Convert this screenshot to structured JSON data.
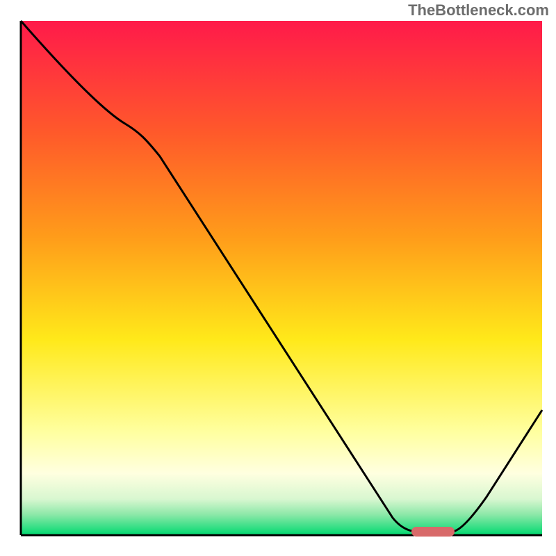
{
  "attribution": "TheBottleneck.com",
  "chart_data": {
    "type": "line",
    "title": "",
    "xlabel": "",
    "ylabel": "",
    "xlim": [
      0,
      100
    ],
    "ylim": [
      0,
      100
    ],
    "grid": false,
    "series": [
      {
        "name": "bottleneck-curve",
        "x": [
          0,
          20,
          72,
          78,
          82,
          100
        ],
        "y": [
          100,
          80,
          1,
          0,
          0,
          25
        ]
      }
    ],
    "marker": {
      "name": "optimal-zone",
      "x_start": 75,
      "x_end": 83,
      "y": 0,
      "color": "#d86a6a"
    },
    "background": {
      "gradient_top": "#ff1a4a",
      "gradient_mid_top": "#ff9c1a",
      "gradient_mid": "#ffe91a",
      "gradient_low": "#ffffcc",
      "gradient_green_light": "#b7f5c3",
      "gradient_bottom": "#00d970"
    },
    "axes_color": "#000000"
  }
}
